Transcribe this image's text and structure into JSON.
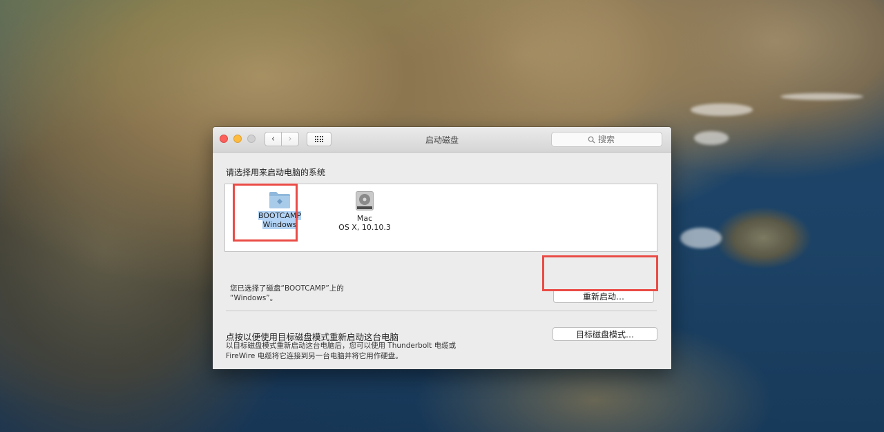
{
  "window": {
    "title": "启动磁盘",
    "search_placeholder": "搜索",
    "nav_back": "‹",
    "nav_forward": "›"
  },
  "startup": {
    "prompt": "请选择用来启动电脑的系统",
    "disks": [
      {
        "line1": "BOOTCAMP",
        "line2": "Windows",
        "icon": "bootcamp-folder-icon",
        "selected": true
      },
      {
        "line1": "Mac",
        "line2": "OS X, 10.10.3",
        "icon": "hard-drive-icon",
        "selected": false
      }
    ],
    "selected_line1": "您已选择了磁盘“BOOTCAMP”上的",
    "selected_line2": "“Windows”。",
    "restart_button": "重新启动…"
  },
  "target_mode": {
    "title": "点按以便使用目标磁盘模式重新启动这台电脑",
    "desc_line1": "以目标磁盘模式重新启动这台电脑后，您可以使用 Thunderbolt 电缆或",
    "desc_line2": "FireWire 电缆将它连接到另一台电脑并将它用作硬盘。",
    "button": "目标磁盘模式…"
  },
  "colors": {
    "highlight": "#ea4b45",
    "selection": "#b2d3f5",
    "close": "#fc605c",
    "minimize": "#fdbc40"
  }
}
